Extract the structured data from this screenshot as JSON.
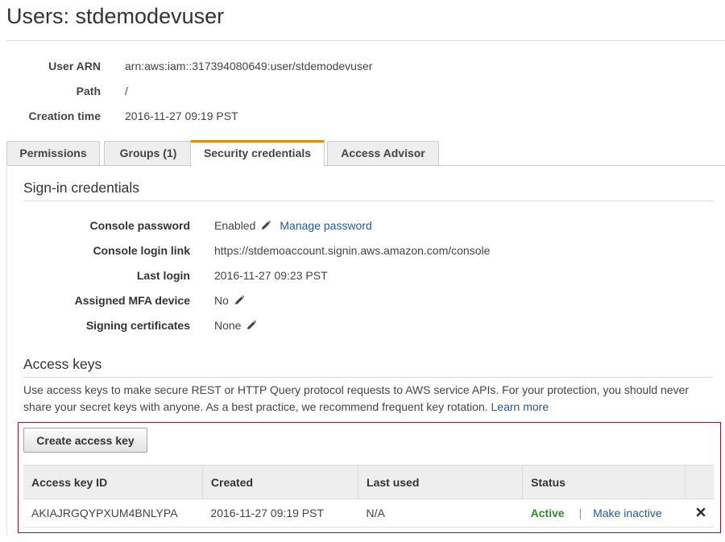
{
  "page": {
    "title": "Users: stdemodevuser"
  },
  "summary": {
    "arn_label": "User ARN",
    "arn_value": "arn:aws:iam::317394080649:user/stdemodevuser",
    "path_label": "Path",
    "path_value": "/",
    "creation_label": "Creation time",
    "creation_value": "2016-11-27 09:19 PST"
  },
  "tabs": [
    {
      "label": "Permissions",
      "active": false
    },
    {
      "label": "Groups (1)",
      "active": false
    },
    {
      "label": "Security credentials",
      "active": true
    },
    {
      "label": "Access Advisor",
      "active": false
    }
  ],
  "signin": {
    "heading": "Sign-in credentials",
    "console_password_label": "Console password",
    "console_password_value": "Enabled",
    "manage_password_link": "Manage password",
    "login_link_label": "Console login link",
    "login_link_value": "https://stdemoaccount.signin.aws.amazon.com/console",
    "last_login_label": "Last login",
    "last_login_value": "2016-11-27 09:23 PST",
    "mfa_label": "Assigned MFA device",
    "mfa_value": "No",
    "signing_label": "Signing certificates",
    "signing_value": "None"
  },
  "access_keys": {
    "heading": "Access keys",
    "description": "Use access keys to make secure REST or HTTP Query protocol requests to AWS service APIs. For your protection, you should never share your secret keys with anyone. As a best practice, we recommend frequent key rotation.",
    "learn_more": "Learn more",
    "create_button": "Create access key",
    "columns": [
      "Access key ID",
      "Created",
      "Last used",
      "Status"
    ],
    "rows": [
      {
        "key_id": "AKIAJRGQYPXUM4BNLYPA",
        "created": "2016-11-27 09:19 PST",
        "last_used": "N/A",
        "status": "Active",
        "separator": "|",
        "action": "Make inactive"
      }
    ]
  },
  "colors": {
    "tab_accent": "#e48a00",
    "link": "#1f5c99",
    "status_active": "#2e8b2e",
    "highlight_border": "#8b1a2b"
  },
  "icons": [
    "pencil-icon",
    "delete-x-icon"
  ]
}
